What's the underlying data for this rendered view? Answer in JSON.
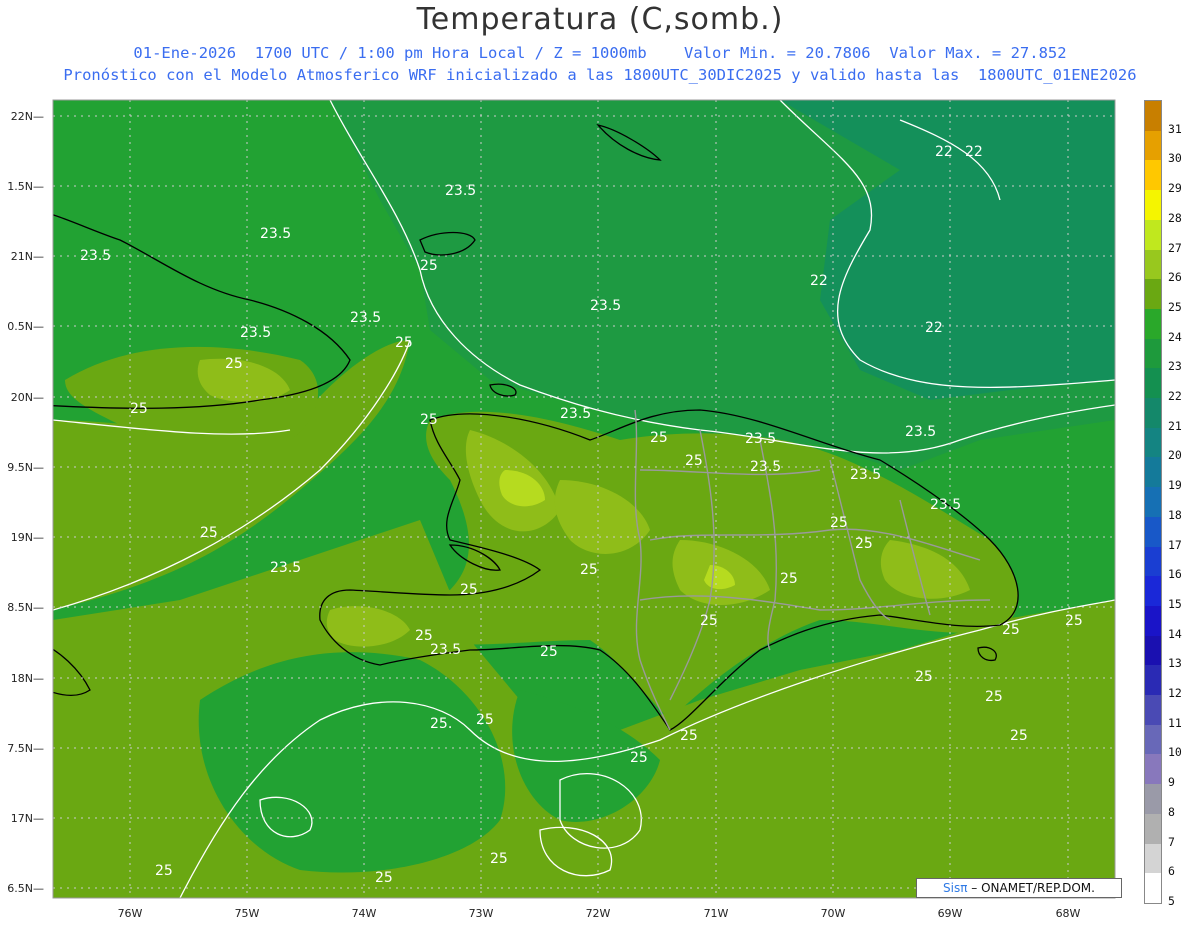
{
  "title": "Temperatura (C,somb.)",
  "subtitle_line1": "01-Ene-2026  1700 UTC / 1:00 pm Hora Local / Z = 1000mb    Valor Min. = 20.7806  Valor Max. = 27.852",
  "subtitle_line2": "Pronóstico con el Modelo Atmosferico WRF inicializado a las 1800UTC_30DIC2025 y valido hasta las  1800UTC_01ENE2026",
  "credit": {
    "brand": "Sisπ",
    "text": " – ONAMET/REP.DOM."
  },
  "colors": {
    "title": "#333333",
    "subtitle": "#3a6df0",
    "field_24": "#22a233",
    "field_23": "#1e9a42",
    "field_22": "#14905a",
    "field_25": "#6aa812",
    "field_26": "#8fbd19",
    "field_27": "#b6db1f",
    "contour": "#ffffff",
    "coastline": "#000000",
    "borders": "#9a9a9a"
  },
  "map": {
    "lon_labels": [
      "76W",
      "75W",
      "74W",
      "73W",
      "72W",
      "71W",
      "70W",
      "69W",
      "68W"
    ],
    "lat_labels": [
      "22N",
      "1.5N",
      "21N",
      "0.5N",
      "20N",
      "9.5N",
      "19N",
      "8.5N",
      "18N",
      "7.5N",
      "17N",
      "6.5N"
    ],
    "contour_labels": [
      "23.5",
      "23.5",
      "23.5",
      "25",
      "23.5",
      "23.5",
      "25",
      "25",
      "25",
      "23.5",
      "25",
      "23.5",
      "25",
      "23.5",
      "25",
      "22",
      "22",
      "22",
      "22",
      "23.5",
      "23.5",
      "23.5",
      "23.5",
      "25",
      "25",
      "25",
      "25",
      "25",
      "25",
      "25",
      "23.5",
      "25",
      "25",
      "23.5",
      "25.",
      "25",
      "25",
      "25",
      "25",
      "25",
      "25",
      "25",
      "25",
      "25",
      "25",
      "25"
    ]
  },
  "colorbar": {
    "labels": [
      "31",
      "30",
      "29",
      "28",
      "27",
      "26",
      "25",
      "24",
      "23",
      "22",
      "21",
      "20",
      "19",
      "18",
      "17",
      "16",
      "15",
      "14",
      "13",
      "12",
      "11",
      "10",
      "9",
      "8",
      "7",
      "6",
      "5"
    ],
    "colors": [
      "#c87f00",
      "#e6a000",
      "#ffc800",
      "#f5f500",
      "#c0e81e",
      "#98c81e",
      "#6aa812",
      "#2aa82a",
      "#1e9a3c",
      "#149050",
      "#14886a",
      "#148482",
      "#147a9a",
      "#1670b4",
      "#1858c8",
      "#1a3ed2",
      "#1a28d8",
      "#1a14c8",
      "#1a10b0",
      "#2a2ab4",
      "#4a4ab4",
      "#6868b8",
      "#8878bc",
      "#9a9aa8",
      "#b0b0b0",
      "#d4d4d4",
      "#ffffff"
    ]
  }
}
